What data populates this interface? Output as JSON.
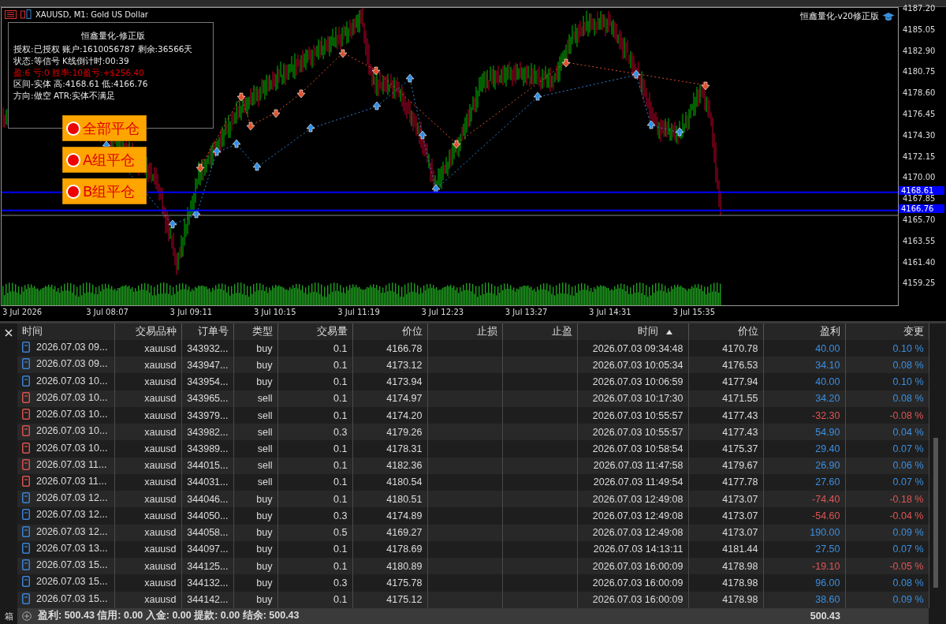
{
  "chart": {
    "title": "XAUUSD, M1:  Gold US Dollar",
    "brand": "恒鑫量化-v20修正版",
    "info_panel": {
      "title": "恒鑫量化-修正版",
      "lines": [
        {
          "text": "授权:已授权 账户:1610056787 剩余:36566天",
          "color": "#e6e6e6"
        },
        {
          "text": "状态:等信号  K线倒计时:00:39",
          "color": "#e6e6e6"
        },
        {
          "text": "盈:6 亏:0 胜率:10盈亏:+$256.40",
          "color": "#e00000"
        },
        {
          "text": "区间-实体 高:4168.61 低:4166.76",
          "color": "#e6e6e6"
        },
        {
          "text": "方向:做空 ATR:实体不满足",
          "color": "#e6e6e6"
        }
      ]
    },
    "buttons": [
      "全部平仓",
      "A组平仓",
      "B组平仓"
    ],
    "price_ticks": [
      "4187.20",
      "4185.05",
      "4182.90",
      "4180.75",
      "4178.60",
      "4176.45",
      "4174.30",
      "4172.15",
      "4170.00",
      "4167.85",
      "4165.70",
      "4163.55",
      "4161.40",
      "4159.25"
    ],
    "levels": [
      {
        "price": "4168.61",
        "color": "#0000ff"
      },
      {
        "price": "4166.76",
        "color": "#0000ff"
      }
    ],
    "time_ticks": [
      "3 Jul 2026",
      "3 Jul 08:07",
      "3 Jul 09:11",
      "3 Jul 10:15",
      "3 Jul 11:19",
      "3 Jul 12:23",
      "3 Jul 13:27",
      "3 Jul 14:31",
      "3 Jul 15:35"
    ]
  },
  "table": {
    "columns": [
      {
        "label": "时间",
        "sorted": false
      },
      {
        "label": "交易品种",
        "sorted": false
      },
      {
        "label": "订单号",
        "sorted": false
      },
      {
        "label": "类型",
        "sorted": false
      },
      {
        "label": "交易量",
        "sorted": false
      },
      {
        "label": "价位",
        "sorted": false
      },
      {
        "label": "止损",
        "sorted": false
      },
      {
        "label": "止盈",
        "sorted": false
      },
      {
        "label": "时间",
        "sorted": true
      },
      {
        "label": "价位",
        "sorted": false
      },
      {
        "label": "盈利",
        "sorted": false
      },
      {
        "label": "变更",
        "sorted": false
      }
    ],
    "rows": [
      {
        "color": "#3b82d6",
        "kind": "profit",
        "cells": [
          "2026.07.03 09...",
          "xauusd",
          "343932...",
          "buy",
          "0.1",
          "4166.78",
          "",
          "",
          "2026.07.03 09:34:48",
          "4170.78",
          "40.00",
          "0.10 %"
        ]
      },
      {
        "color": "#3b82d6",
        "kind": "profit",
        "cells": [
          "2026.07.03 09...",
          "xauusd",
          "343947...",
          "buy",
          "0.1",
          "4173.12",
          "",
          "",
          "2026.07.03 10:05:34",
          "4176.53",
          "34.10",
          "0.08 %"
        ]
      },
      {
        "color": "#3b82d6",
        "kind": "profit",
        "cells": [
          "2026.07.03 10...",
          "xauusd",
          "343954...",
          "buy",
          "0.1",
          "4173.94",
          "",
          "",
          "2026.07.03 10:06:59",
          "4177.94",
          "40.00",
          "0.10 %"
        ]
      },
      {
        "color": "#d9534f",
        "kind": "profit",
        "cells": [
          "2026.07.03 10...",
          "xauusd",
          "343965...",
          "sell",
          "0.1",
          "4174.97",
          "",
          "",
          "2026.07.03 10:17:30",
          "4171.55",
          "34.20",
          "0.08 %"
        ]
      },
      {
        "color": "#d9534f",
        "kind": "loss",
        "cells": [
          "2026.07.03 10...",
          "xauusd",
          "343979...",
          "sell",
          "0.1",
          "4174.20",
          "",
          "",
          "2026.07.03 10:55:57",
          "4177.43",
          "-32.30",
          "-0.08 %"
        ]
      },
      {
        "color": "#d9534f",
        "kind": "profit",
        "cells": [
          "2026.07.03 10...",
          "xauusd",
          "343982...",
          "sell",
          "0.3",
          "4179.26",
          "",
          "",
          "2026.07.03 10:55:57",
          "4177.43",
          "54.90",
          "0.04 %"
        ]
      },
      {
        "color": "#d9534f",
        "kind": "profit",
        "cells": [
          "2026.07.03 10...",
          "xauusd",
          "343989...",
          "sell",
          "0.1",
          "4178.31",
          "",
          "",
          "2026.07.03 10:58:54",
          "4175.37",
          "29.40",
          "0.07 %"
        ]
      },
      {
        "color": "#d9534f",
        "kind": "profit",
        "cells": [
          "2026.07.03 11...",
          "xauusd",
          "344015...",
          "sell",
          "0.1",
          "4182.36",
          "",
          "",
          "2026.07.03 11:47:58",
          "4179.67",
          "26.90",
          "0.06 %"
        ]
      },
      {
        "color": "#d9534f",
        "kind": "profit",
        "cells": [
          "2026.07.03 11...",
          "xauusd",
          "344031...",
          "sell",
          "0.1",
          "4180.54",
          "",
          "",
          "2026.07.03 11:49:54",
          "4177.78",
          "27.60",
          "0.07 %"
        ]
      },
      {
        "color": "#3b82d6",
        "kind": "loss",
        "cells": [
          "2026.07.03 12...",
          "xauusd",
          "344046...",
          "buy",
          "0.1",
          "4180.51",
          "",
          "",
          "2026.07.03 12:49:08",
          "4173.07",
          "-74.40",
          "-0.18 %"
        ]
      },
      {
        "color": "#3b82d6",
        "kind": "loss",
        "cells": [
          "2026.07.03 12...",
          "xauusd",
          "344050...",
          "buy",
          "0.3",
          "4174.89",
          "",
          "",
          "2026.07.03 12:49:08",
          "4173.07",
          "-54.60",
          "-0.04 %"
        ]
      },
      {
        "color": "#3b82d6",
        "kind": "profit",
        "cells": [
          "2026.07.03 12...",
          "xauusd",
          "344058...",
          "buy",
          "0.5",
          "4169.27",
          "",
          "",
          "2026.07.03 12:49:08",
          "4173.07",
          "190.00",
          "0.09 %"
        ]
      },
      {
        "color": "#3b82d6",
        "kind": "profit",
        "cells": [
          "2026.07.03 13...",
          "xauusd",
          "344097...",
          "buy",
          "0.1",
          "4178.69",
          "",
          "",
          "2026.07.03 14:13:11",
          "4181.44",
          "27.50",
          "0.07 %"
        ]
      },
      {
        "color": "#3b82d6",
        "kind": "loss",
        "cells": [
          "2026.07.03 15...",
          "xauusd",
          "344125...",
          "buy",
          "0.1",
          "4180.89",
          "",
          "",
          "2026.07.03 16:00:09",
          "4178.98",
          "-19.10",
          "-0.05 %"
        ]
      },
      {
        "color": "#3b82d6",
        "kind": "profit",
        "cells": [
          "2026.07.03 15...",
          "xauusd",
          "344132...",
          "buy",
          "0.3",
          "4175.78",
          "",
          "",
          "2026.07.03 16:00:09",
          "4178.98",
          "96.00",
          "0.08 %"
        ]
      },
      {
        "color": "#3b82d6",
        "kind": "profit",
        "cells": [
          "2026.07.03 15...",
          "xauusd",
          "344142...",
          "buy",
          "0.1",
          "4175.12",
          "",
          "",
          "2026.07.03 16:00:09",
          "4178.98",
          "38.60",
          "0.09 %"
        ]
      }
    ],
    "summary": "盈利: 500.43  信用: 0.00  入金: 0.00  提款: 0.00  结余: 500.43",
    "total_profit": "500.43"
  },
  "side_panel": {
    "label": "箱"
  }
}
